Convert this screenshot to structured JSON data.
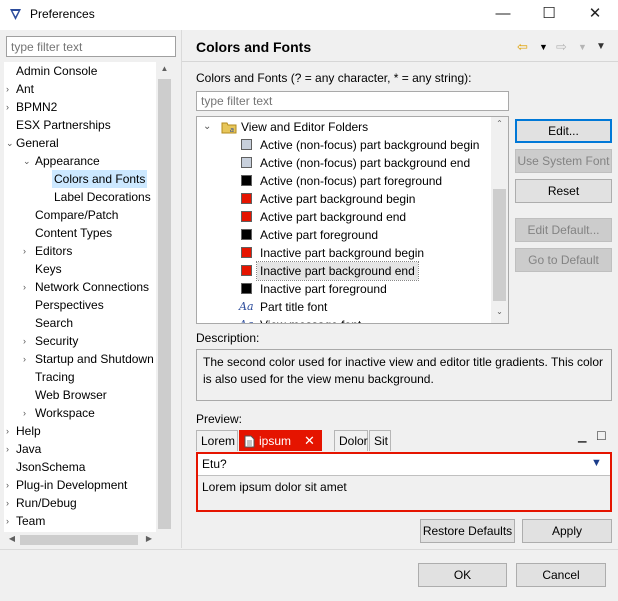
{
  "window": {
    "title": "Preferences",
    "minimize": "—",
    "maximize": "☐",
    "close": "✕"
  },
  "left": {
    "filter_placeholder": "type filter text",
    "tree": [
      {
        "label": "Admin Console",
        "level": 0,
        "twisty": ""
      },
      {
        "label": "Ant",
        "level": 0,
        "twisty": "›"
      },
      {
        "label": "BPMN2",
        "level": 0,
        "twisty": "›"
      },
      {
        "label": "ESX Partnerships",
        "level": 0,
        "twisty": ""
      },
      {
        "label": "General",
        "level": 0,
        "twisty": "⌄"
      },
      {
        "label": "Appearance",
        "level": 1,
        "twisty": "⌄"
      },
      {
        "label": "Colors and Fonts",
        "level": 2,
        "twisty": "",
        "selected": true
      },
      {
        "label": "Label Decorations",
        "level": 2,
        "twisty": ""
      },
      {
        "label": "Compare/Patch",
        "level": 1,
        "twisty": ""
      },
      {
        "label": "Content Types",
        "level": 1,
        "twisty": ""
      },
      {
        "label": "Editors",
        "level": 1,
        "twisty": "›"
      },
      {
        "label": "Keys",
        "level": 1,
        "twisty": ""
      },
      {
        "label": "Network Connections",
        "level": 1,
        "twisty": "›"
      },
      {
        "label": "Perspectives",
        "level": 1,
        "twisty": ""
      },
      {
        "label": "Search",
        "level": 1,
        "twisty": ""
      },
      {
        "label": "Security",
        "level": 1,
        "twisty": "›"
      },
      {
        "label": "Startup and Shutdown",
        "level": 1,
        "twisty": "›"
      },
      {
        "label": "Tracing",
        "level": 1,
        "twisty": ""
      },
      {
        "label": "Web Browser",
        "level": 1,
        "twisty": ""
      },
      {
        "label": "Workspace",
        "level": 1,
        "twisty": "›"
      },
      {
        "label": "Help",
        "level": 0,
        "twisty": "›"
      },
      {
        "label": "Java",
        "level": 0,
        "twisty": "›"
      },
      {
        "label": "JsonSchema",
        "level": 0,
        "twisty": ""
      },
      {
        "label": "Plug-in Development",
        "level": 0,
        "twisty": "›"
      },
      {
        "label": "Run/Debug",
        "level": 0,
        "twisty": "›"
      },
      {
        "label": "Team",
        "level": 0,
        "twisty": "›"
      }
    ]
  },
  "right": {
    "title": "Colors and Fonts",
    "subtitle": "Colors and Fonts (? = any character, * = any string):",
    "filter_placeholder": "type filter text",
    "group": "View and Editor Folders",
    "items": [
      {
        "label": "Active (non-focus) part background begin",
        "kind": "color",
        "color": "#c8d0dc"
      },
      {
        "label": "Active (non-focus) part background end",
        "kind": "color",
        "color": "#c8d0dc"
      },
      {
        "label": "Active (non-focus) part foreground",
        "kind": "color",
        "color": "#000000"
      },
      {
        "label": "Active part background begin",
        "kind": "color",
        "color": "#e51400"
      },
      {
        "label": "Active part background end",
        "kind": "color",
        "color": "#e51400"
      },
      {
        "label": "Active part foreground",
        "kind": "color",
        "color": "#000000"
      },
      {
        "label": "Inactive part background begin",
        "kind": "color",
        "color": "#e51400"
      },
      {
        "label": "Inactive part background end",
        "kind": "color",
        "color": "#e51400",
        "selected": true
      },
      {
        "label": "Inactive part foreground",
        "kind": "color",
        "color": "#000000"
      },
      {
        "label": "Part title font",
        "kind": "font",
        "glyph": "Aa"
      },
      {
        "label": "View message font",
        "kind": "font",
        "glyph": "Aa"
      }
    ],
    "buttons": {
      "edit": "Edit...",
      "use_system_font": "Use System Font",
      "reset": "Reset",
      "edit_default": "Edit Default...",
      "go_to_default": "Go to Default"
    },
    "description_label": "Description:",
    "description": "The second color used for inactive view and editor title gradients.  This color is also used for the view menu background.",
    "preview_label": "Preview:",
    "preview_tabs": [
      "Lorem",
      "ipsum",
      "Dolor",
      "Sit"
    ],
    "preview_combo": "Etu?",
    "preview_text": "Lorem ipsum dolor sit amet",
    "restore_defaults": "Restore Defaults",
    "apply": "Apply"
  },
  "footer": {
    "ok": "OK",
    "cancel": "Cancel"
  },
  "colors": {
    "accent_red": "#e51400",
    "selection": "#cce8ff",
    "focus_blue": "#0078d7"
  }
}
